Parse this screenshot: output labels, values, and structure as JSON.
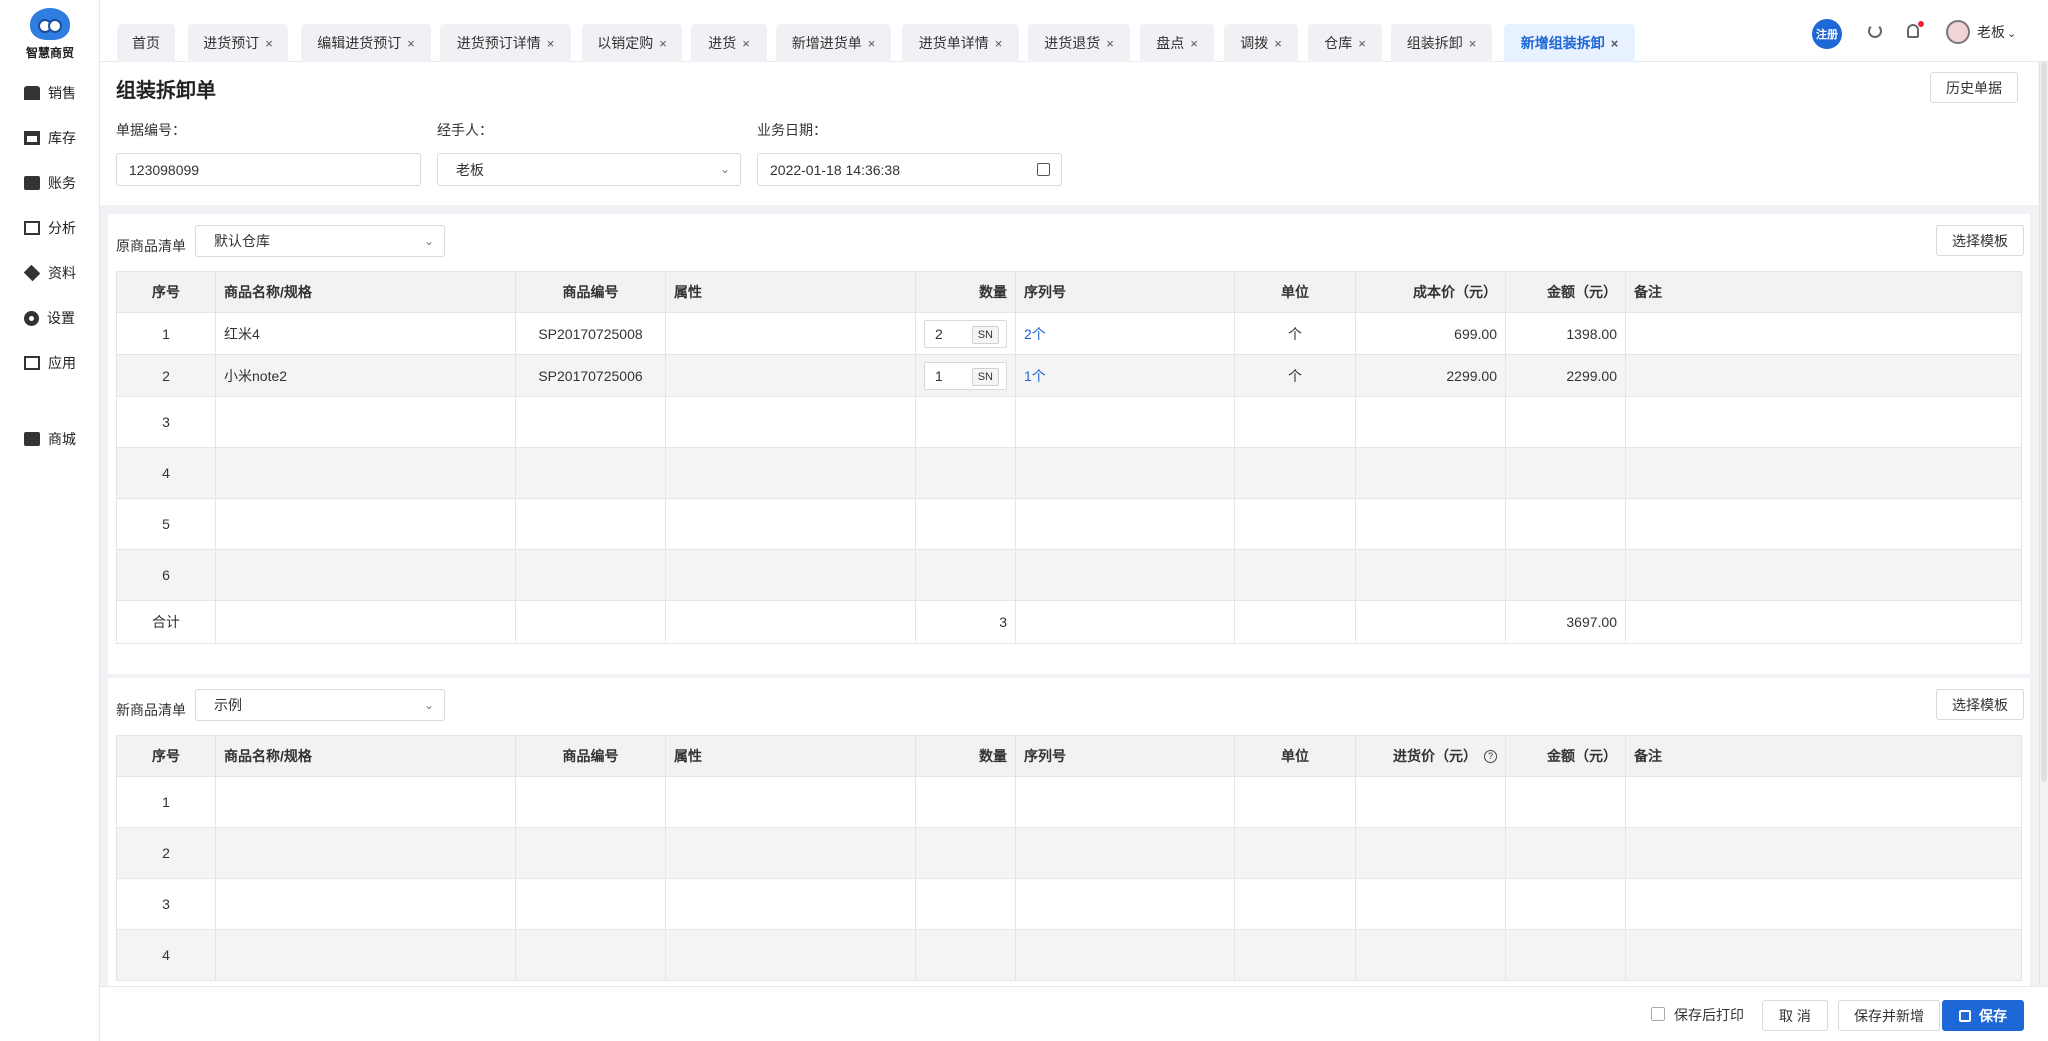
{
  "app": {
    "logo_text": "智慧商贸",
    "nav": [
      {
        "label": "销售",
        "icon": "store-icon"
      },
      {
        "label": "库存",
        "icon": "inventory-icon"
      },
      {
        "label": "账务",
        "icon": "wallet-icon"
      },
      {
        "label": "分析",
        "icon": "chart-icon"
      },
      {
        "label": "资料",
        "icon": "cube-icon"
      },
      {
        "label": "设置",
        "icon": "gear-icon"
      },
      {
        "label": "应用",
        "icon": "grid-icon"
      },
      {
        "label": "商城",
        "icon": "shopping-bag-icon"
      }
    ]
  },
  "tabs": [
    {
      "label": "首页",
      "closable": false
    },
    {
      "label": "进货预订",
      "closable": true
    },
    {
      "label": "编辑进货预订",
      "closable": true
    },
    {
      "label": "进货预订详情",
      "closable": true
    },
    {
      "label": "以销定购",
      "closable": true
    },
    {
      "label": "进货",
      "closable": true
    },
    {
      "label": "新增进货单",
      "closable": true
    },
    {
      "label": "进货单详情",
      "closable": true
    },
    {
      "label": "进货退货",
      "closable": true
    },
    {
      "label": "盘点",
      "closable": true
    },
    {
      "label": "调拨",
      "closable": true
    },
    {
      "label": "仓库",
      "closable": true
    },
    {
      "label": "组装拆卸",
      "closable": true
    },
    {
      "label": "新增组装拆卸",
      "closable": true,
      "active": true
    }
  ],
  "topbar": {
    "register": "注册",
    "user": "老板",
    "close_symbol": "×"
  },
  "page": {
    "title": "组装拆卸单",
    "history_button": "历史单据",
    "document_no_label": "单据编号：",
    "document_no": "123098099",
    "handler_label": "经手人：",
    "handler": "老板",
    "business_date_label": "业务日期：",
    "business_date": "2022-01-18 14:36:38"
  },
  "source_items": {
    "title": "原商品清单",
    "warehouse": "默认仓库",
    "template_button": "选择模板",
    "headers": [
      "序号",
      "商品名称/规格",
      "商品编号",
      "属性",
      "数量",
      "序列号",
      "单位",
      "成本价（元）",
      "金额（元）",
      "备注"
    ],
    "rows": [
      {
        "index": "1",
        "name": "红米4",
        "code": "SP20170725008",
        "attribute": "",
        "quantity": "2",
        "serial": "2个",
        "unit": "个",
        "price": "699.00",
        "amount": "1398.00",
        "note": ""
      },
      {
        "index": "2",
        "name": "小米note2",
        "code": "SP20170725006",
        "attribute": "",
        "quantity": "1",
        "serial": "1个",
        "unit": "个",
        "price": "2299.00",
        "amount": "2299.00",
        "note": ""
      },
      {
        "index": "3"
      },
      {
        "index": "4"
      },
      {
        "index": "5"
      },
      {
        "index": "6"
      }
    ],
    "total_label": "合计",
    "total_quantity": "3",
    "total_amount": "3697.00",
    "sn_label": "SN"
  },
  "new_items": {
    "title": "新商品清单",
    "example": "示例",
    "template_button": "选择模板",
    "headers": [
      "序号",
      "商品名称/规格",
      "商品编号",
      "属性",
      "数量",
      "序列号",
      "单位",
      "进货价（元）",
      "金额（元）",
      "备注"
    ],
    "rows": [
      {
        "index": "1"
      },
      {
        "index": "2"
      },
      {
        "index": "3"
      },
      {
        "index": "4"
      }
    ],
    "help_symbol": "?"
  },
  "footer": {
    "print_after_save": "保存后打印",
    "cancel": "取 消",
    "save_and_new": "保存并新增",
    "save": "保存"
  }
}
